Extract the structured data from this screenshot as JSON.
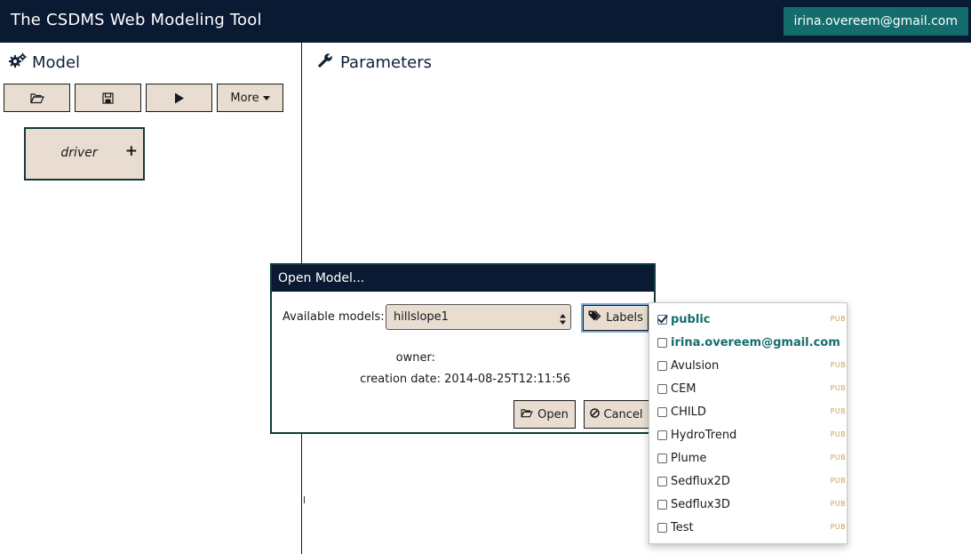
{
  "header": {
    "title": "The CSDMS Web Modeling Tool",
    "user": "irina.overeem@gmail.com"
  },
  "colors": {
    "header_bg": "#0b1a33",
    "accent": "#146d6d",
    "button_bg": "#e8ddd0",
    "badge": "#c9a25a"
  },
  "model_panel": {
    "title": "Model",
    "title_icon": "gears-icon",
    "toolbar": {
      "open_icon": "folder-open-icon",
      "save_icon": "floppy-disk-icon",
      "run_icon": "play-icon",
      "more_label": "More"
    },
    "driver": {
      "label": "driver",
      "add_symbol": "+"
    }
  },
  "parameters_panel": {
    "title": "Parameters",
    "title_icon": "wrench-icon"
  },
  "open_dialog": {
    "title": "Open Model...",
    "available_label": "Available models:",
    "selected_model": "hillslope1",
    "labels_button": "Labels",
    "owner_label": "owner:",
    "owner_value": "",
    "creation_date_label": "creation date:",
    "creation_date_value": "2014-08-25T12:11:56",
    "open_button": "Open",
    "cancel_button": "Cancel"
  },
  "labels_menu": {
    "items": [
      {
        "name": "public",
        "checked": true,
        "strong": true,
        "badge": "PUB"
      },
      {
        "name": "irina.overeem@gmail.com",
        "checked": false,
        "strong": true,
        "badge": ""
      },
      {
        "name": "Avulsion",
        "checked": false,
        "strong": false,
        "badge": "PUB"
      },
      {
        "name": "CEM",
        "checked": false,
        "strong": false,
        "badge": "PUB"
      },
      {
        "name": "CHILD",
        "checked": false,
        "strong": false,
        "badge": "PUB"
      },
      {
        "name": "HydroTrend",
        "checked": false,
        "strong": false,
        "badge": "PUB"
      },
      {
        "name": "Plume",
        "checked": false,
        "strong": false,
        "badge": "PUB"
      },
      {
        "name": "Sedflux2D",
        "checked": false,
        "strong": false,
        "badge": "PUB"
      },
      {
        "name": "Sedflux3D",
        "checked": false,
        "strong": false,
        "badge": "PUB"
      },
      {
        "name": "Test",
        "checked": false,
        "strong": false,
        "badge": "PUB"
      }
    ]
  }
}
